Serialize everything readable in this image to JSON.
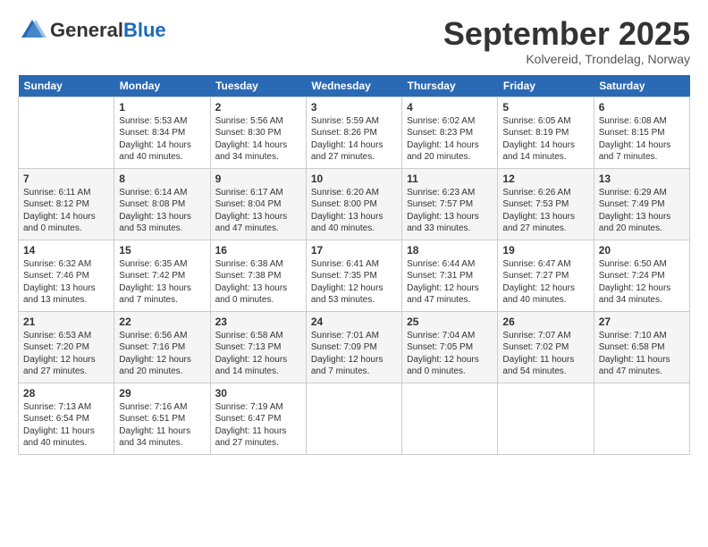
{
  "logo": {
    "general": "General",
    "blue": "Blue"
  },
  "header": {
    "title": "September 2025",
    "subtitle": "Kolvereid, Trondelag, Norway"
  },
  "weekdays": [
    "Sunday",
    "Monday",
    "Tuesday",
    "Wednesday",
    "Thursday",
    "Friday",
    "Saturday"
  ],
  "weeks": [
    [
      {
        "day": "",
        "empty": true
      },
      {
        "day": "1",
        "sunrise": "Sunrise: 5:53 AM",
        "sunset": "Sunset: 8:34 PM",
        "daylight": "Daylight: 14 hours and 40 minutes."
      },
      {
        "day": "2",
        "sunrise": "Sunrise: 5:56 AM",
        "sunset": "Sunset: 8:30 PM",
        "daylight": "Daylight: 14 hours and 34 minutes."
      },
      {
        "day": "3",
        "sunrise": "Sunrise: 5:59 AM",
        "sunset": "Sunset: 8:26 PM",
        "daylight": "Daylight: 14 hours and 27 minutes."
      },
      {
        "day": "4",
        "sunrise": "Sunrise: 6:02 AM",
        "sunset": "Sunset: 8:23 PM",
        "daylight": "Daylight: 14 hours and 20 minutes."
      },
      {
        "day": "5",
        "sunrise": "Sunrise: 6:05 AM",
        "sunset": "Sunset: 8:19 PM",
        "daylight": "Daylight: 14 hours and 14 minutes."
      },
      {
        "day": "6",
        "sunrise": "Sunrise: 6:08 AM",
        "sunset": "Sunset: 8:15 PM",
        "daylight": "Daylight: 14 hours and 7 minutes."
      }
    ],
    [
      {
        "day": "7",
        "sunrise": "Sunrise: 6:11 AM",
        "sunset": "Sunset: 8:12 PM",
        "daylight": "Daylight: 14 hours and 0 minutes."
      },
      {
        "day": "8",
        "sunrise": "Sunrise: 6:14 AM",
        "sunset": "Sunset: 8:08 PM",
        "daylight": "Daylight: 13 hours and 53 minutes."
      },
      {
        "day": "9",
        "sunrise": "Sunrise: 6:17 AM",
        "sunset": "Sunset: 8:04 PM",
        "daylight": "Daylight: 13 hours and 47 minutes."
      },
      {
        "day": "10",
        "sunrise": "Sunrise: 6:20 AM",
        "sunset": "Sunset: 8:00 PM",
        "daylight": "Daylight: 13 hours and 40 minutes."
      },
      {
        "day": "11",
        "sunrise": "Sunrise: 6:23 AM",
        "sunset": "Sunset: 7:57 PM",
        "daylight": "Daylight: 13 hours and 33 minutes."
      },
      {
        "day": "12",
        "sunrise": "Sunrise: 6:26 AM",
        "sunset": "Sunset: 7:53 PM",
        "daylight": "Daylight: 13 hours and 27 minutes."
      },
      {
        "day": "13",
        "sunrise": "Sunrise: 6:29 AM",
        "sunset": "Sunset: 7:49 PM",
        "daylight": "Daylight: 13 hours and 20 minutes."
      }
    ],
    [
      {
        "day": "14",
        "sunrise": "Sunrise: 6:32 AM",
        "sunset": "Sunset: 7:46 PM",
        "daylight": "Daylight: 13 hours and 13 minutes."
      },
      {
        "day": "15",
        "sunrise": "Sunrise: 6:35 AM",
        "sunset": "Sunset: 7:42 PM",
        "daylight": "Daylight: 13 hours and 7 minutes."
      },
      {
        "day": "16",
        "sunrise": "Sunrise: 6:38 AM",
        "sunset": "Sunset: 7:38 PM",
        "daylight": "Daylight: 13 hours and 0 minutes."
      },
      {
        "day": "17",
        "sunrise": "Sunrise: 6:41 AM",
        "sunset": "Sunset: 7:35 PM",
        "daylight": "Daylight: 12 hours and 53 minutes."
      },
      {
        "day": "18",
        "sunrise": "Sunrise: 6:44 AM",
        "sunset": "Sunset: 7:31 PM",
        "daylight": "Daylight: 12 hours and 47 minutes."
      },
      {
        "day": "19",
        "sunrise": "Sunrise: 6:47 AM",
        "sunset": "Sunset: 7:27 PM",
        "daylight": "Daylight: 12 hours and 40 minutes."
      },
      {
        "day": "20",
        "sunrise": "Sunrise: 6:50 AM",
        "sunset": "Sunset: 7:24 PM",
        "daylight": "Daylight: 12 hours and 34 minutes."
      }
    ],
    [
      {
        "day": "21",
        "sunrise": "Sunrise: 6:53 AM",
        "sunset": "Sunset: 7:20 PM",
        "daylight": "Daylight: 12 hours and 27 minutes."
      },
      {
        "day": "22",
        "sunrise": "Sunrise: 6:56 AM",
        "sunset": "Sunset: 7:16 PM",
        "daylight": "Daylight: 12 hours and 20 minutes."
      },
      {
        "day": "23",
        "sunrise": "Sunrise: 6:58 AM",
        "sunset": "Sunset: 7:13 PM",
        "daylight": "Daylight: 12 hours and 14 minutes."
      },
      {
        "day": "24",
        "sunrise": "Sunrise: 7:01 AM",
        "sunset": "Sunset: 7:09 PM",
        "daylight": "Daylight: 12 hours and 7 minutes."
      },
      {
        "day": "25",
        "sunrise": "Sunrise: 7:04 AM",
        "sunset": "Sunset: 7:05 PM",
        "daylight": "Daylight: 12 hours and 0 minutes."
      },
      {
        "day": "26",
        "sunrise": "Sunrise: 7:07 AM",
        "sunset": "Sunset: 7:02 PM",
        "daylight": "Daylight: 11 hours and 54 minutes."
      },
      {
        "day": "27",
        "sunrise": "Sunrise: 7:10 AM",
        "sunset": "Sunset: 6:58 PM",
        "daylight": "Daylight: 11 hours and 47 minutes."
      }
    ],
    [
      {
        "day": "28",
        "sunrise": "Sunrise: 7:13 AM",
        "sunset": "Sunset: 6:54 PM",
        "daylight": "Daylight: 11 hours and 40 minutes."
      },
      {
        "day": "29",
        "sunrise": "Sunrise: 7:16 AM",
        "sunset": "Sunset: 6:51 PM",
        "daylight": "Daylight: 11 hours and 34 minutes."
      },
      {
        "day": "30",
        "sunrise": "Sunrise: 7:19 AM",
        "sunset": "Sunset: 6:47 PM",
        "daylight": "Daylight: 11 hours and 27 minutes."
      },
      {
        "day": "",
        "empty": true
      },
      {
        "day": "",
        "empty": true
      },
      {
        "day": "",
        "empty": true
      },
      {
        "day": "",
        "empty": true
      }
    ]
  ]
}
